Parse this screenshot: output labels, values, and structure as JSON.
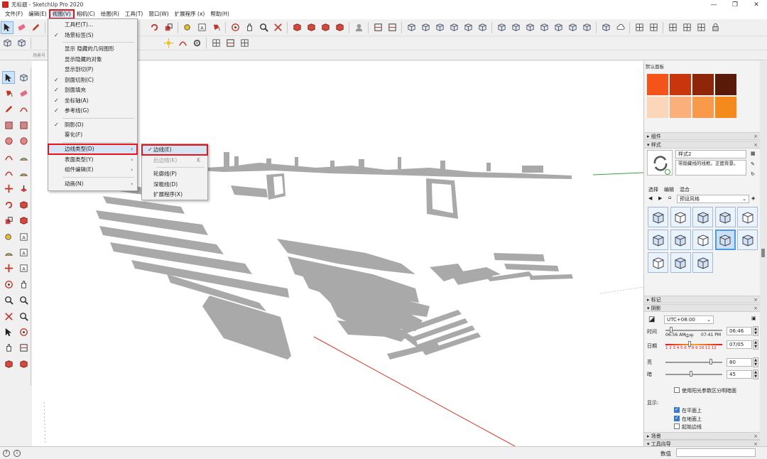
{
  "window": {
    "title": "无标题 - SketchUp Pro 2020",
    "minimize": "—",
    "maximize": "❐",
    "close": "✕"
  },
  "menubar": [
    {
      "label": "文件(F)",
      "active": false
    },
    {
      "label": "编辑(E)",
      "active": false
    },
    {
      "label": "视图(V)",
      "active": true
    },
    {
      "label": "相机(C)",
      "active": false
    },
    {
      "label": "绘图(R)",
      "active": false
    },
    {
      "label": "工具(T)",
      "active": false
    },
    {
      "label": "窗口(W)",
      "active": false
    },
    {
      "label": "扩展程序 (x)",
      "active": false
    },
    {
      "label": "帮助(H)",
      "active": false
    }
  ],
  "toolbar3_label": "场景号",
  "view_menu": {
    "items": [
      {
        "label": "工具栏(T)...",
        "checked": false,
        "submenu": false
      },
      {
        "label": "场景标签(S)",
        "checked": true,
        "submenu": false
      },
      {
        "sep": true
      },
      {
        "label": "显示 隐藏的几何图形",
        "checked": false,
        "submenu": false
      },
      {
        "label": "显示隐藏的对象",
        "checked": false,
        "submenu": false
      },
      {
        "label": "显示剖切(P)",
        "checked": false,
        "submenu": false
      },
      {
        "label": "剖面切割(C)",
        "checked": true,
        "submenu": false
      },
      {
        "label": "剖面填充",
        "checked": true,
        "submenu": false
      },
      {
        "label": "坐标轴(A)",
        "checked": true,
        "submenu": false
      },
      {
        "label": "参考线(G)",
        "checked": true,
        "submenu": false
      },
      {
        "sep": true
      },
      {
        "label": "阴影(D)",
        "checked": true,
        "submenu": false
      },
      {
        "label": "雾化(F)",
        "checked": false,
        "submenu": false
      },
      {
        "sep": true
      },
      {
        "label": "边线类型(D)",
        "checked": false,
        "submenu": true,
        "highlight": true
      },
      {
        "label": "表面类型(Y)",
        "checked": false,
        "submenu": true
      },
      {
        "label": "组件编辑(E)",
        "checked": false,
        "submenu": true
      },
      {
        "sep": true
      },
      {
        "label": "动画(N)",
        "checked": false,
        "submenu": true
      }
    ]
  },
  "edge_menu": {
    "items": [
      {
        "label": "边线(E)",
        "checked": true,
        "highlight": true,
        "disabled": false,
        "shortcut": ""
      },
      {
        "label": "后边线(K)",
        "checked": false,
        "highlight": false,
        "disabled": true,
        "shortcut": "K"
      },
      {
        "sep": true
      },
      {
        "label": "轮廓线(P)",
        "checked": false,
        "highlight": false,
        "disabled": false,
        "shortcut": ""
      },
      {
        "label": "深粗线(D)",
        "checked": false,
        "highlight": false,
        "disabled": false,
        "shortcut": ""
      },
      {
        "label": "扩展程序(X)",
        "checked": false,
        "highlight": false,
        "disabled": false,
        "shortcut": ""
      }
    ]
  },
  "right_panel": {
    "title": "默认面板",
    "swatches": [
      "#f4541a",
      "#c7360d",
      "#8f2609",
      "#5a1a08",
      "#fbd6b8",
      "#fbb07b",
      "#f89a4a",
      "#f58a1c"
    ],
    "tray_components": "组件",
    "tray_styles": "样式",
    "style_name": "样式2",
    "style_desc": "带隐藏线的线框。正面背景。",
    "style_tabs": [
      "选择",
      "编辑",
      "混合"
    ],
    "style_folder": "预设风格",
    "tray_tags": "标记",
    "tray_shadows": "阴影",
    "timezone": "UTC+08:00",
    "time_label": "时间",
    "time_start": "06:56 AM",
    "time_mid": "中午",
    "time_end": "07:41 PM",
    "time_value": "06:46",
    "date_label": "日期",
    "months": "1 2 3 4 5 6 7 8 9 10 11 12",
    "date_value": "07/05",
    "light_label": "亮",
    "light_value": "80",
    "dark_label": "暗",
    "dark_value": "45",
    "sun_shading": "使用阳光参数区分明暗面",
    "display_label": "显示:",
    "on_faces": "在平面上",
    "on_ground": "在地面上",
    "from_edges": "起始边线",
    "tray_scenes": "场景",
    "tray_instructor": "工具向导",
    "accent": "#e8141a",
    "selection_blue": "#4d9ae3"
  },
  "status": {
    "measure_label": "数值",
    "measure_value": ""
  }
}
